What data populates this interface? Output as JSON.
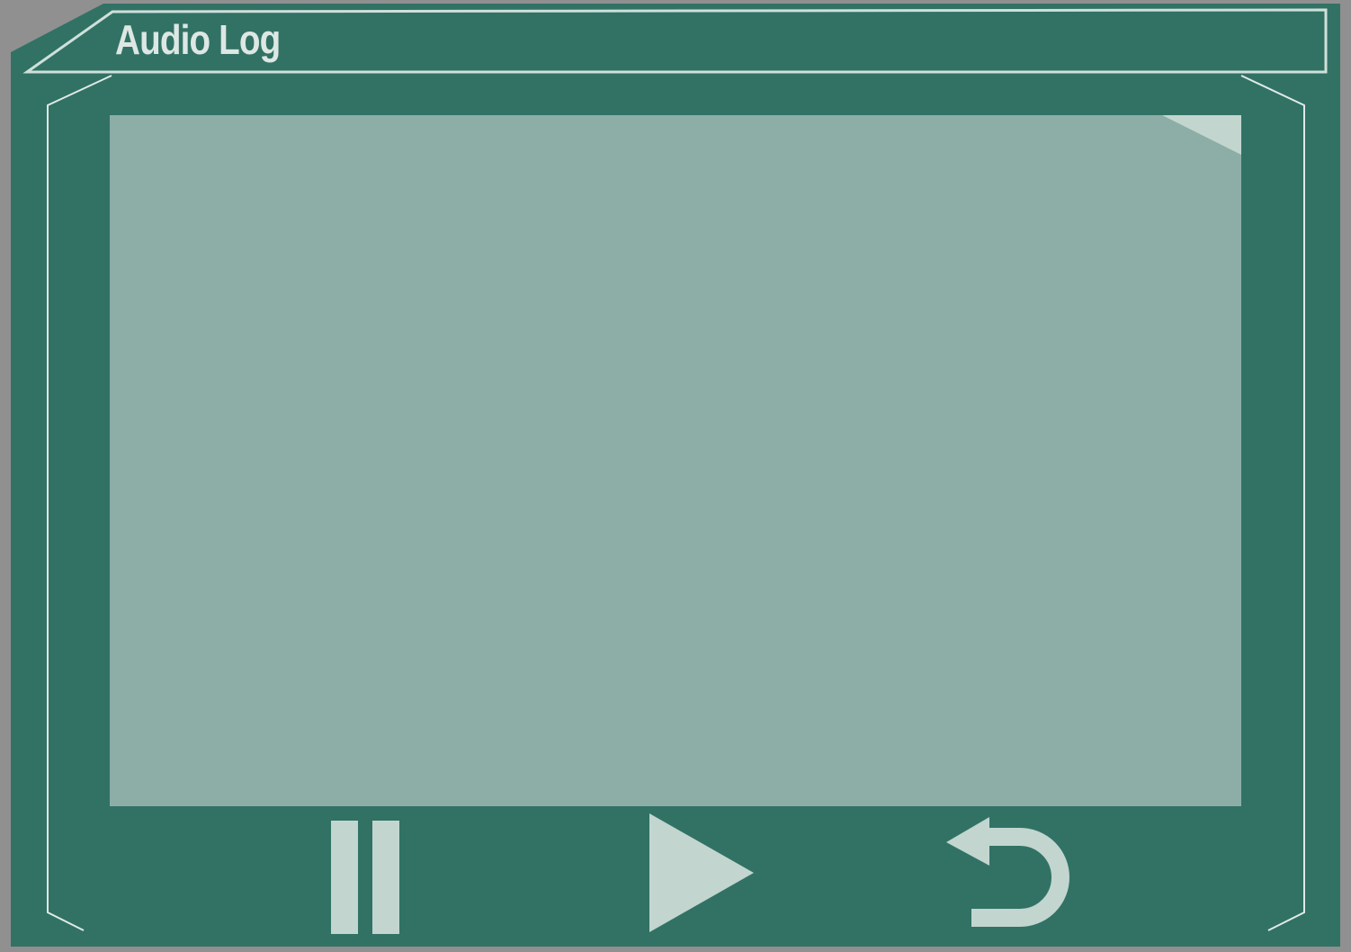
{
  "window": {
    "title": "Audio Log"
  },
  "controls": {
    "pause_icon": "pause-icon",
    "play_icon": "play-icon",
    "replay_icon": "replay-icon"
  },
  "colors": {
    "panel": "#317265",
    "screen": "#8caea6",
    "icon": "#c2d5cf",
    "outline": "#d8e6e1",
    "frame_gray": "#909090"
  }
}
